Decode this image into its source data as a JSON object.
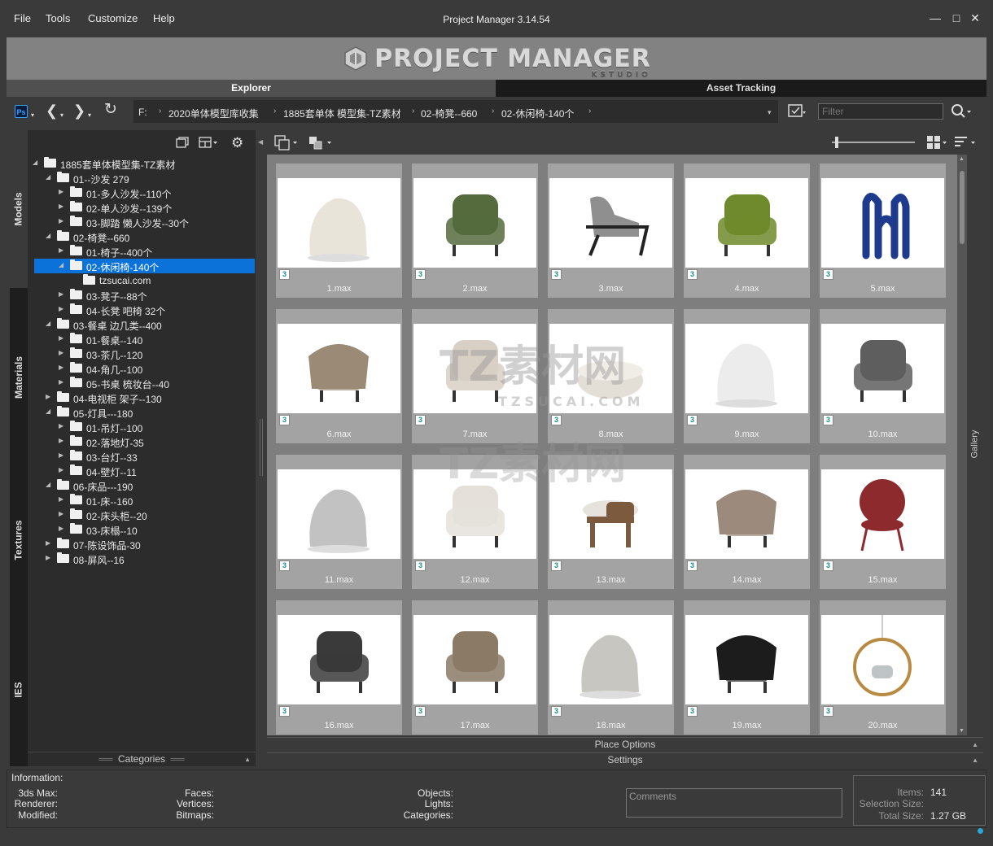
{
  "menu": {
    "file": "File",
    "tools": "Tools",
    "customize": "Customize",
    "help": "Help"
  },
  "window": {
    "title": "Project Manager 3.14.54",
    "minimize": "—",
    "maximize": "□",
    "close": "✕"
  },
  "banner": {
    "logo_text": "PROJECT MANAGER",
    "logo_sub": "KSTUDIO"
  },
  "tabs": {
    "explorer": "Explorer",
    "asset_tracking": "Asset Tracking"
  },
  "toolbar": {
    "ps_label": "Ps",
    "breadcrumbs": [
      "F:",
      "2020单体模型库收集",
      "1885套单体 模型集-TZ素材",
      "02-椅凳--660",
      "02-休闲椅-140个"
    ],
    "filter_placeholder": "Filter"
  },
  "side_tabs": [
    "Models",
    "Materials",
    "Textures",
    "IES"
  ],
  "tree": [
    {
      "label": "1885套单体模型集-TZ素材",
      "level": 0,
      "expanded": true,
      "folder": true
    },
    {
      "label": "01--沙发 279",
      "level": 1,
      "expanded": true,
      "folder": true
    },
    {
      "label": "01-多人沙发--110个",
      "level": 2,
      "expanded": false,
      "folder": true
    },
    {
      "label": "02-单人沙发--139个",
      "level": 2,
      "expanded": false,
      "folder": true
    },
    {
      "label": "03-脚踏 懒人沙发--30个",
      "level": 2,
      "expanded": false,
      "folder": true
    },
    {
      "label": "02-椅凳--660",
      "level": 1,
      "expanded": true,
      "folder": true
    },
    {
      "label": "01-椅子--400个",
      "level": 2,
      "expanded": false,
      "folder": true
    },
    {
      "label": "02-休闲椅-140个",
      "level": 2,
      "expanded": true,
      "folder": true,
      "selected": true
    },
    {
      "label": "tzsucai.com",
      "level": 3,
      "expanded": null,
      "folder": true
    },
    {
      "label": "03-凳子--88个",
      "level": 2,
      "expanded": false,
      "folder": true
    },
    {
      "label": "04-长凳 吧椅 32个",
      "level": 2,
      "expanded": false,
      "folder": true
    },
    {
      "label": "03-餐桌 边几类--400",
      "level": 1,
      "expanded": true,
      "folder": true
    },
    {
      "label": "01-餐桌--140",
      "level": 2,
      "expanded": false,
      "folder": true
    },
    {
      "label": "03-茶几--120",
      "level": 2,
      "expanded": false,
      "folder": true
    },
    {
      "label": "04-角几--100",
      "level": 2,
      "expanded": false,
      "folder": true
    },
    {
      "label": "05-书桌 梳妆台--40",
      "level": 2,
      "expanded": false,
      "folder": true
    },
    {
      "label": "04-电视柜 架子--130",
      "level": 1,
      "expanded": false,
      "folder": true
    },
    {
      "label": "05-灯具---180",
      "level": 1,
      "expanded": true,
      "folder": true
    },
    {
      "label": "01-吊灯--100",
      "level": 2,
      "expanded": false,
      "folder": true
    },
    {
      "label": "02-落地灯-35",
      "level": 2,
      "expanded": false,
      "folder": true
    },
    {
      "label": "03-台灯--33",
      "level": 2,
      "expanded": false,
      "folder": true
    },
    {
      "label": "04-壁灯--11",
      "level": 2,
      "expanded": false,
      "folder": true
    },
    {
      "label": "06-床品---190",
      "level": 1,
      "expanded": true,
      "folder": true
    },
    {
      "label": "01-床--160",
      "level": 2,
      "expanded": false,
      "folder": true
    },
    {
      "label": "02-床头柜--20",
      "level": 2,
      "expanded": false,
      "folder": true
    },
    {
      "label": "03-床榻--10",
      "level": 2,
      "expanded": false,
      "folder": true
    },
    {
      "label": "07-陈设饰品-30",
      "level": 1,
      "expanded": false,
      "folder": true
    },
    {
      "label": "08-屏风--16",
      "level": 1,
      "expanded": false,
      "folder": true
    }
  ],
  "categories_label": "Categories",
  "gallery": {
    "side_label": "Gallery",
    "badge": "3",
    "items": [
      {
        "name": "1.max",
        "color": "#e9e4da",
        "shape": "lounge"
      },
      {
        "name": "2.max",
        "color": "#556b3e",
        "shape": "armchair"
      },
      {
        "name": "3.max",
        "color": "#8f8f8f",
        "shape": "recliner"
      },
      {
        "name": "4.max",
        "color": "#6f8a2c",
        "shape": "armchair"
      },
      {
        "name": "5.max",
        "color": "#1e3a8c",
        "shape": "wiggle"
      },
      {
        "name": "6.max",
        "color": "#9a8a76",
        "shape": "tub"
      },
      {
        "name": "7.max",
        "color": "#d8d0c4",
        "shape": "armchair"
      },
      {
        "name": "8.max",
        "color": "#e3ded6",
        "shape": "pouf"
      },
      {
        "name": "9.max",
        "color": "#ececec",
        "shape": "lounge"
      },
      {
        "name": "10.max",
        "color": "#5e5e5e",
        "shape": "armchair"
      },
      {
        "name": "11.max",
        "color": "#c2c2c2",
        "shape": "lounge"
      },
      {
        "name": "12.max",
        "color": "#e5e1da",
        "shape": "armchair"
      },
      {
        "name": "13.max",
        "color": "#7c5a3e",
        "shape": "stool"
      },
      {
        "name": "14.max",
        "color": "#9c8b7c",
        "shape": "tub"
      },
      {
        "name": "15.max",
        "color": "#8c2a2e",
        "shape": "round"
      },
      {
        "name": "16.max",
        "color": "#3a3a3a",
        "shape": "armchair"
      },
      {
        "name": "17.max",
        "color": "#8a7a66",
        "shape": "armchair"
      },
      {
        "name": "18.max",
        "color": "#c8c6c0",
        "shape": "lounge"
      },
      {
        "name": "19.max",
        "color": "#1c1c1c",
        "shape": "tub"
      },
      {
        "name": "20.max",
        "color": "#b88b44",
        "shape": "ring"
      }
    ]
  },
  "place_options": "Place Options",
  "settings": "Settings",
  "info": {
    "title": "Information:",
    "max_label": "3ds Max:",
    "renderer_label": "Renderer:",
    "modified_label": "Modified:",
    "faces_label": "Faces:",
    "vertices_label": "Vertices:",
    "bitmaps_label": "Bitmaps:",
    "objects_label": "Objects:",
    "lights_label": "Lights:",
    "categories_label": "Categories:",
    "comments_placeholder": "Comments",
    "items_label": "Items:",
    "items_value": "141",
    "selection_label": "Selection Size:",
    "selection_value": "",
    "total_label": "Total Size:",
    "total_value": "1.27 GB"
  },
  "watermark": {
    "big": "TZ素材网",
    "small": "TZSUCAI.COM"
  }
}
